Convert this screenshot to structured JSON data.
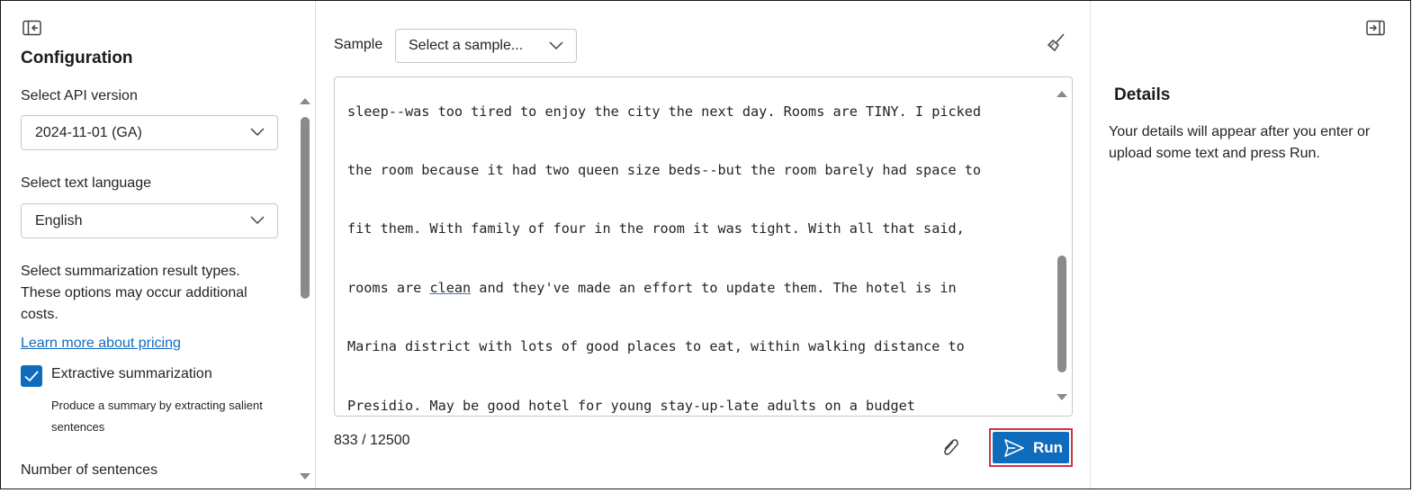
{
  "left_panel": {
    "title": "Configuration",
    "api_version_label": "Select API version",
    "api_version_value": "2024-11-01 (GA)",
    "language_label": "Select text language",
    "language_value": "English",
    "result_types_text": "Select summarization result types. These options may occur additional costs.",
    "pricing_link": "Learn more about pricing",
    "extractive_checkbox_label": "Extractive summarization",
    "extractive_checkbox_checked": true,
    "extractive_desc": "Produce a summary by extracting salient sentences",
    "num_sentences_label": "Number of sentences"
  },
  "main": {
    "sample_label": "Sample",
    "sample_placeholder": "Select a sample...",
    "text_lines": [
      "sleep--was too tired to enjoy the city the next day. Rooms are TINY. I picked",
      "the room because it had two queen size beds--but the room barely had space to",
      "fit them. With family of four in the room it was tight. With all that said,",
      [
        "rooms are ",
        "clean",
        " and they've made an effort to update them. The hotel is in"
      ],
      "Marina district with lots of good places to eat, within walking distance to",
      "Presidio. May be good hotel for young stay-up-late adults on a budget"
    ],
    "line4_pre": "rooms are ",
    "line4_word": "clean",
    "line4_post": " and they've made an effort to update them. The hotel is in",
    "char_count": "833 / 12500",
    "run_label": "Run"
  },
  "right_panel": {
    "title": "Details",
    "text": "Your details will appear after you enter or upload some text and press Run."
  },
  "colors": {
    "accent": "#0f6cbd",
    "highlight_border": "#d13438",
    "scroll_thumb": "#8a8a8a"
  },
  "icons": {
    "collapse": "panel-collapse-left-icon",
    "expand": "panel-expand-right-icon",
    "clear": "broom-icon",
    "attach": "paperclip-icon",
    "send": "send-icon",
    "chevron": "chevron-down-icon",
    "check": "checkmark-icon"
  }
}
